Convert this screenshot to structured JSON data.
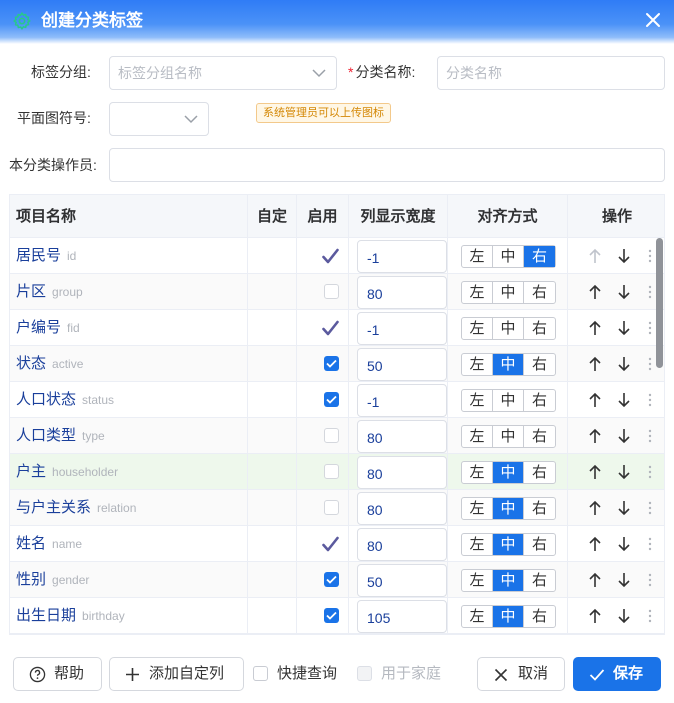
{
  "dialog": {
    "title": "创建分类标签"
  },
  "form": {
    "tag_group_label": "标签分组:",
    "tag_group_placeholder": "标签分组名称",
    "required_mark": "*",
    "category_name_label": "分类名称:",
    "category_name_placeholder": "分类名称",
    "map_symbol_label": "平面图符号:",
    "hint": "系统管理员可以上传图标",
    "operator_label": "本分类操作员:"
  },
  "table": {
    "headers": [
      "项目名称",
      "自定",
      "启用",
      "列显示宽度",
      "对齐方式",
      "操作"
    ],
    "align_options": [
      "左",
      "中",
      "右"
    ],
    "rows": [
      {
        "name": "居民号",
        "code": "id",
        "enabled": "tick",
        "width": "-1",
        "align": 2,
        "up_enabled": false
      },
      {
        "name": "片区",
        "code": "group",
        "enabled": "off",
        "width": "80",
        "align": -1,
        "up_enabled": true
      },
      {
        "name": "户编号",
        "code": "fid",
        "enabled": "tick",
        "width": "-1",
        "align": -1,
        "up_enabled": true
      },
      {
        "name": "状态",
        "code": "active",
        "enabled": "on",
        "width": "50",
        "align": 1,
        "up_enabled": true
      },
      {
        "name": "人口状态",
        "code": "status",
        "enabled": "on",
        "width": "-1",
        "align": -1,
        "up_enabled": true
      },
      {
        "name": "人口类型",
        "code": "type",
        "enabled": "off",
        "width": "80",
        "align": -1,
        "up_enabled": true
      },
      {
        "name": "户主",
        "code": "householder",
        "enabled": "off",
        "width": "80",
        "align": 1,
        "up_enabled": true,
        "highlight": true
      },
      {
        "name": "与户主关系",
        "code": "relation",
        "enabled": "off",
        "width": "80",
        "align": 1,
        "up_enabled": true
      },
      {
        "name": "姓名",
        "code": "name",
        "enabled": "tick",
        "width": "80",
        "align": 1,
        "up_enabled": true
      },
      {
        "name": "性别",
        "code": "gender",
        "enabled": "on",
        "width": "50",
        "align": 1,
        "up_enabled": true
      },
      {
        "name": "出生日期",
        "code": "birthday",
        "enabled": "on",
        "width": "105",
        "align": 1,
        "up_enabled": true
      }
    ]
  },
  "footer": {
    "help": "帮助",
    "add_custom_column": "添加自定列",
    "quick_query": "快捷查询",
    "for_family": "用于家庭",
    "cancel": "取消",
    "save": "保存"
  },
  "colors": {
    "primary": "#1a73e8",
    "title_gradient_top": "#2f7cf6",
    "checkmark": "#5b5a9e",
    "highlight_row": "#eef8ec"
  },
  "icons": [
    "gear-icon",
    "close-icon",
    "chevron-down-icon",
    "checkmark-icon",
    "arrow-up-icon",
    "arrow-down-icon",
    "more-vertical-icon",
    "help-icon",
    "plus-icon",
    "x-icon"
  ]
}
